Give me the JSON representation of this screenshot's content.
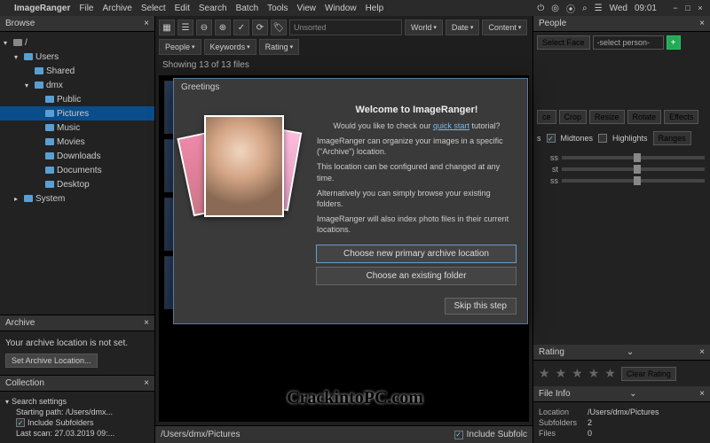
{
  "menubar": {
    "items": [
      "File",
      "Archive",
      "Select",
      "Edit",
      "Search",
      "Batch",
      "Tools",
      "View",
      "Window",
      "Help"
    ],
    "app": "ImageRanger",
    "day": "Wed",
    "time": "09:01"
  },
  "browse": {
    "title": "Browse",
    "root": "/",
    "nodes": [
      "Users",
      "Shared",
      "dmx",
      "Public",
      "Pictures",
      "Music",
      "Movies",
      "Downloads",
      "Documents",
      "Desktop",
      "System"
    ]
  },
  "archive": {
    "title": "Archive",
    "msg": "Your archive location is not set.",
    "btn": "Set Archive Location..."
  },
  "collection": {
    "title": "Collection",
    "search_settings": "Search settings",
    "starting_path": "Starting path: /Users/dmx...",
    "include_sub": "Include Subfolders",
    "last_scan": "Last scan: 27.03.2019 09:..."
  },
  "toolbar": {
    "unsorted": "Unsorted",
    "filters": [
      "World",
      "Date",
      "Content"
    ],
    "filters2": [
      "People",
      "Keywords",
      "Rating"
    ]
  },
  "status": "Showing 13 of 13 files",
  "pathbar": {
    "path": "/Users/dmx/Pictures",
    "include": "Include Subfolc"
  },
  "people": {
    "title": "People",
    "select_face": "Select Face",
    "placeholder": "-select person-"
  },
  "edit_btns": [
    "ce",
    "Crop",
    "Resize",
    "Rotate",
    "Effects"
  ],
  "tone": {
    "s_label": "s",
    "midtones": "Midtones",
    "highlights": "Highlights",
    "ranges": "Ranges"
  },
  "sliders": [
    "ss",
    "st",
    "ss"
  ],
  "rating": {
    "title": "Rating",
    "clear": "Clear Rating"
  },
  "fileinfo": {
    "title": "File Info",
    "rows": {
      "Location": "/Users/dmx/Pictures",
      "Subfolders": "2",
      "Files": "0"
    }
  },
  "modal": {
    "greet": "Greetings",
    "title": "Welcome to ImageRanger!",
    "sub": "Would you like to check our ",
    "link": "quick start",
    "sub2": " tutorial?",
    "p1": "ImageRanger can organize your images in a specific (\"Archive\") location.",
    "p2": "This location can be configured and changed at any time.",
    "p3": "Alternatively you can simply browse your existing folders.",
    "p4": "ImageRanger will also index photo files in their current locations.",
    "btn1": "Choose new primary archive location",
    "btn2": "Choose an existing folder",
    "skip": "Skip this step"
  },
  "watermark": "CrackintoPC.com"
}
